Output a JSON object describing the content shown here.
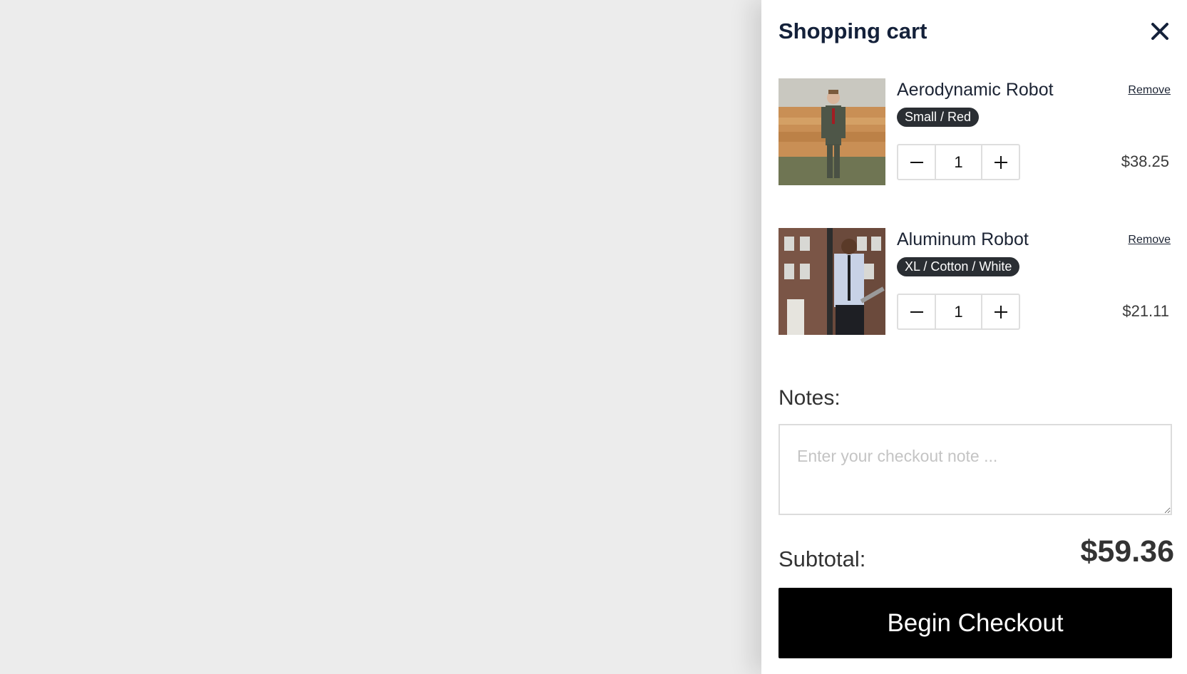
{
  "cart": {
    "title": "Shopping cart",
    "items": [
      {
        "name": "Aerodynamic Robot",
        "variant": "Small / Red",
        "quantity": "1",
        "price": "$38.25",
        "remove_label": "Remove",
        "image": "man-in-green-suit-in-field-photo"
      },
      {
        "name": "Aluminum Robot",
        "variant": "XL / Cotton / White",
        "quantity": "1",
        "price": "$21.11",
        "remove_label": "Remove",
        "image": "man-in-white-shirt-by-brick-building-photo"
      }
    ],
    "notes": {
      "label": "Notes:",
      "placeholder": "Enter your checkout note ...",
      "value": ""
    },
    "subtotal": {
      "label": "Subtotal:",
      "value": "$59.36"
    },
    "checkout_label": "Begin Checkout"
  },
  "icons": {
    "close": "close-icon",
    "minus": "minus-icon",
    "plus": "plus-icon"
  },
  "colors": {
    "overlay": "#ececec",
    "title": "#14213a",
    "badge": "#2a2e33",
    "checkout_button": "#000000"
  }
}
